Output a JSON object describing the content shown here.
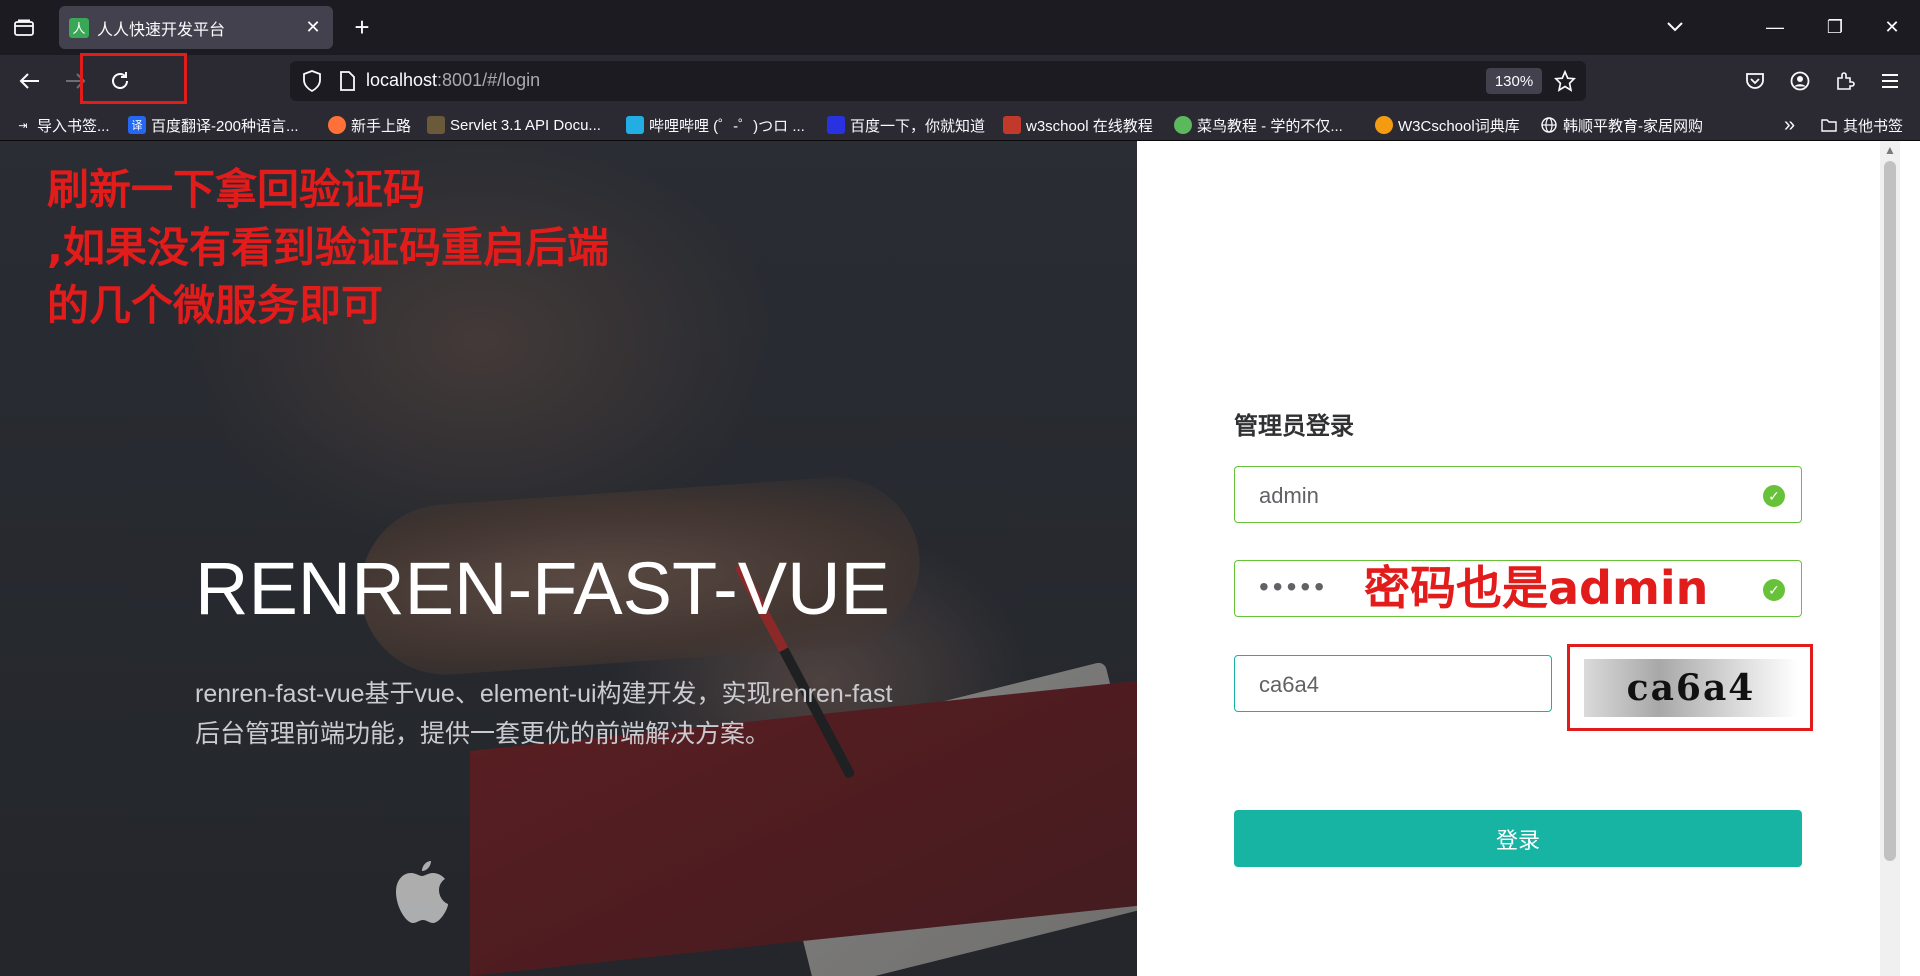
{
  "tabbar": {
    "tab_title": "人人快速开发平台",
    "favicon_char": "人",
    "close_glyph": "✕",
    "new_tab_glyph": "+",
    "minimize_glyph": "—",
    "restore_glyph": "❐",
    "close_window_glyph": "✕",
    "tab_list_glyph": "⌄"
  },
  "navbar": {
    "url_host": "localhost",
    "url_path": ":8001/#/login",
    "zoom": "130%"
  },
  "bookmarks": [
    {
      "label": "导入书签...",
      "icon_color": "#2b2a33",
      "icon": "import-icon"
    },
    {
      "label": "百度翻译-200种语言...",
      "icon_color": "#2468f2",
      "icon": "baidu-translate-icon"
    },
    {
      "label": "新手上路",
      "icon_color": "#ff7139",
      "icon": "firefox-icon"
    },
    {
      "label": "Servlet 3.1 API Docu...",
      "icon_color": "#6b5a3a",
      "icon": "servlet-icon"
    },
    {
      "label": "哔哩哔哩 (゜-゜)つロ ...",
      "icon_color": "#23ade5",
      "icon": "bilibili-icon"
    },
    {
      "label": "百度一下，你就知道",
      "icon_color": "#2932e1",
      "icon": "baidu-icon"
    },
    {
      "label": "w3school 在线教程",
      "icon_color": "#c0392b",
      "icon": "w3school-icon"
    },
    {
      "label": "菜鸟教程 - 学的不仅...",
      "icon_color": "#5cb85c",
      "icon": "runoob-icon"
    },
    {
      "label": "W3Cschool词典库",
      "icon_color": "#f39c12",
      "icon": "w3cschool-icon"
    },
    {
      "label": "韩顺平教育-家居网购",
      "icon_color": "#2b2a33",
      "icon": "globe-icon"
    }
  ],
  "bookmarks_overflow": "»",
  "other_bookmarks": "其他书签",
  "hero": {
    "title": "RENREN-FAST-VUE",
    "desc_line1": "renren-fast-vue基于vue、element-ui构建开发，实现renren-fast",
    "desc_line2": "后台管理前端功能，提供一套更优的前端解决方案。"
  },
  "annotations": {
    "refresh_line1": "刷新一下拿回验证码",
    "refresh_line2": ",如果没有看到验证码重启后端",
    "refresh_line3": "的几个微服务即可",
    "password_note": "密码也是admin"
  },
  "login": {
    "title": "管理员登录",
    "username_value": "admin",
    "password_mask": "•••••",
    "captcha_value": "ca6a4",
    "captcha_image_text": "ca6a4",
    "submit_label": "登录"
  }
}
